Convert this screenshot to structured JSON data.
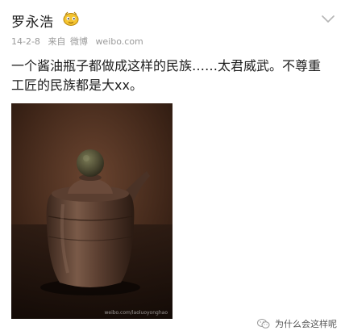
{
  "post": {
    "author": "罗永浩",
    "date": "14-2-8",
    "from_label": "来自",
    "source": "微博",
    "source_domain": "weibo.com",
    "text_line1": "一个酱油瓶子都做成这样的民族……太君威武。不尊重",
    "text_line2": "工匠的民族都是大xx。"
  },
  "photo": {
    "watermark": "weibo.com/laoluoyonghao"
  },
  "watermark": {
    "text": "为什么会这样呢"
  },
  "icons": {
    "vip": "vip-badge-icon",
    "menu": "chevron-down-icon",
    "wechat": "wechat-icon"
  },
  "colors": {
    "text": "#1e1e1e",
    "meta": "#9a9a9a",
    "photo_bg": "#3a2418"
  }
}
